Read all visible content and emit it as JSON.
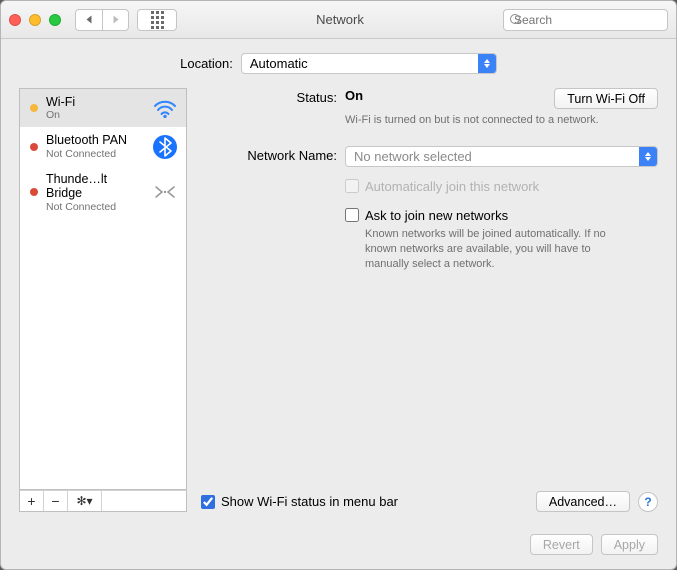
{
  "window": {
    "title": "Network"
  },
  "search": {
    "placeholder": "Search"
  },
  "location": {
    "label": "Location:",
    "value": "Automatic"
  },
  "sidebar": {
    "items": [
      {
        "name": "Wi-Fi",
        "sub": "On",
        "dot": "#f6b73c",
        "icon": "wifi",
        "selected": true
      },
      {
        "name": "Bluetooth PAN",
        "sub": "Not Connected",
        "dot": "#d94a3a",
        "icon": "bluetooth",
        "selected": false
      },
      {
        "name": "Thunde…lt Bridge",
        "sub": "Not Connected",
        "dot": "#d94a3a",
        "icon": "bridge",
        "selected": false
      }
    ]
  },
  "detail": {
    "status_label": "Status:",
    "status_value": "On",
    "turn_off": "Turn Wi-Fi Off",
    "status_desc": "Wi-Fi is turned on but is not connected to a network.",
    "netname_label": "Network Name:",
    "netname_value": "No network selected",
    "autojoin": "Automatically join this network",
    "asktojoin": "Ask to join new networks",
    "asktojoin_desc": "Known networks will be joined automatically. If no known networks are available, you will have to manually select a network.",
    "show_status": "Show Wi-Fi status in menu bar",
    "advanced": "Advanced…"
  },
  "buttons": {
    "revert": "Revert",
    "apply": "Apply"
  }
}
